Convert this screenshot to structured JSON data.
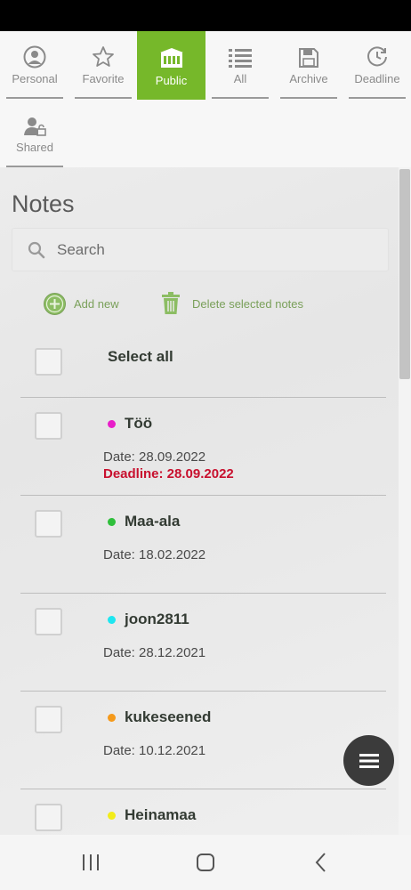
{
  "tabs": [
    {
      "label": "Personal",
      "icon": "person-circle-icon"
    },
    {
      "label": "Favorite",
      "icon": "star-icon"
    },
    {
      "label": "Public",
      "icon": "building-icon",
      "active": true
    },
    {
      "label": "All",
      "icon": "list-icon"
    },
    {
      "label": "Archive",
      "icon": "save-icon"
    },
    {
      "label": "Deadline",
      "icon": "clock-icon"
    },
    {
      "label": "Shared",
      "icon": "shared-user-icon"
    }
  ],
  "notes_header": {
    "title": "Notes"
  },
  "search": {
    "placeholder": "Search",
    "value": ""
  },
  "actions": {
    "add_new": "Add new",
    "delete_selected": "Delete selected notes"
  },
  "select_all": {
    "label": "Select all"
  },
  "notes": [
    {
      "title": "Töö",
      "date": "Date: 28.09.2022",
      "deadline": "Deadline: 28.09.2022",
      "color": "#e81ec9"
    },
    {
      "title": "Maa-ala",
      "date": "Date: 18.02.2022",
      "color": "#2fbf3b"
    },
    {
      "title": "joon2811",
      "date": "Date: 28.12.2021",
      "color": "#1ee6f0"
    },
    {
      "title": "kukeseened",
      "date": "Date: 10.12.2021",
      "color": "#f59a1b"
    },
    {
      "title": "Heinamaa",
      "color": "#f2ec1a"
    }
  ],
  "colors": {
    "accent": "#76b82a",
    "deadline": "#c8102e",
    "fab": "#3b3b3b"
  }
}
